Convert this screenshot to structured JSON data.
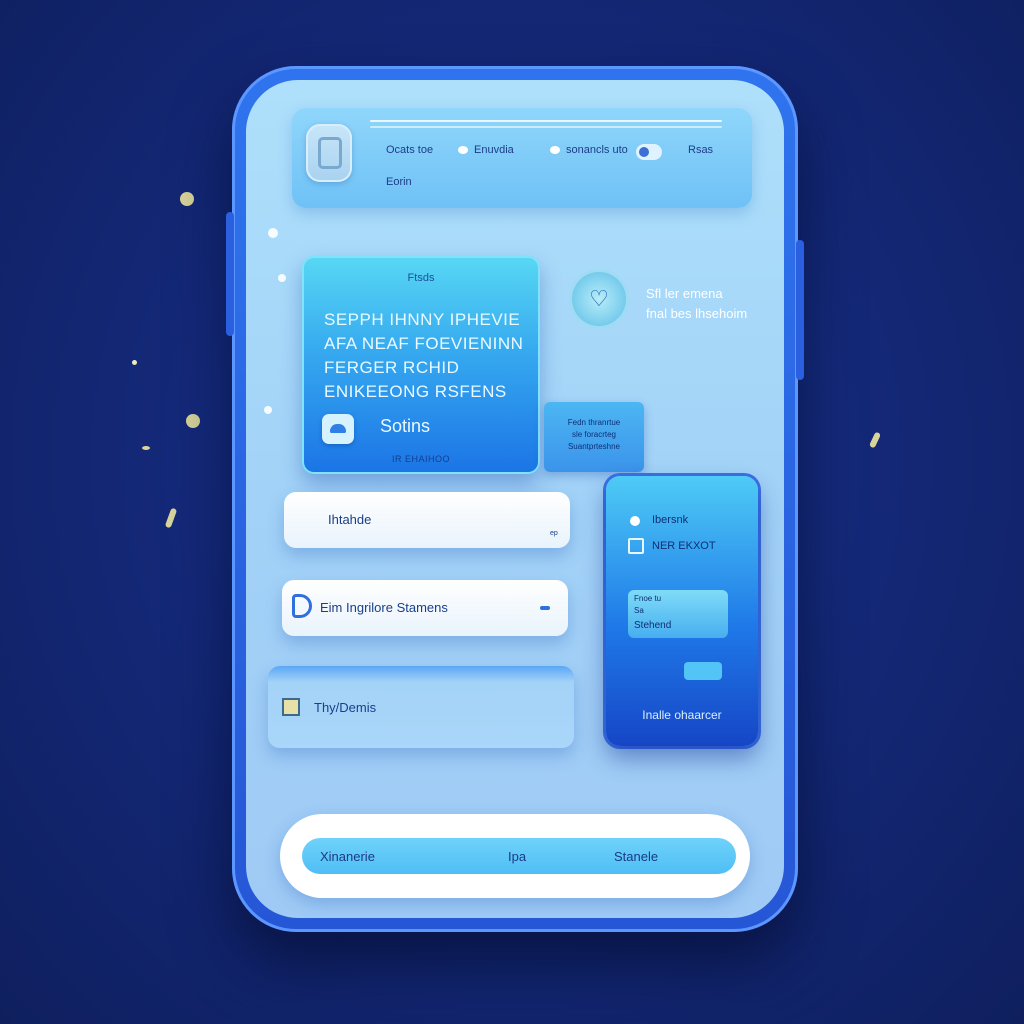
{
  "header": {
    "items": [
      "Ocats toe",
      "Enuvdia",
      "sonancls uto",
      "Rsas"
    ],
    "sub_label": "Eorin"
  },
  "hero": {
    "title": "Ftsds",
    "lines": [
      "SEPPH IHNNY IPHEVIE",
      "AFA NEAF FOEVIENINN",
      "FERGER RCHID",
      "ENIKEEONG RSFENS"
    ],
    "button_label": "Sotins",
    "footer": "IR EHAIHOO"
  },
  "badge": {
    "lines": [
      "Sfl ler emena",
      "fnal bes lhsehoim"
    ]
  },
  "mini_card": {
    "lines": [
      "Fedn thranrtue",
      "sle foracrteg",
      "Suantprteshne"
    ]
  },
  "list_items": [
    {
      "label": "Ihtahde",
      "note": "ep"
    },
    {
      "label": "Eim Ingrilore Stamens"
    },
    {
      "label": "Thy/Demis"
    }
  ],
  "side_card": {
    "title": "Ibersnk",
    "subtitle": "NER EKXOT",
    "inner_lines": [
      "Fnoe tu",
      "Sa",
      "Stehend"
    ],
    "footer": "Inalle ohaarcer"
  },
  "tabbar": {
    "tabs": [
      "Xinanerie",
      "Ipa",
      "Stanele"
    ]
  },
  "colors": {
    "background": "#14297a",
    "phone_frame": "#2f74ee",
    "screen": "#a2d2f7",
    "accent": "#35a8ef"
  },
  "icons": [
    "app-logo-icon",
    "heart-icon",
    "d-icon",
    "note-icon",
    "cloud-icon",
    "chevron-down-icon"
  ]
}
